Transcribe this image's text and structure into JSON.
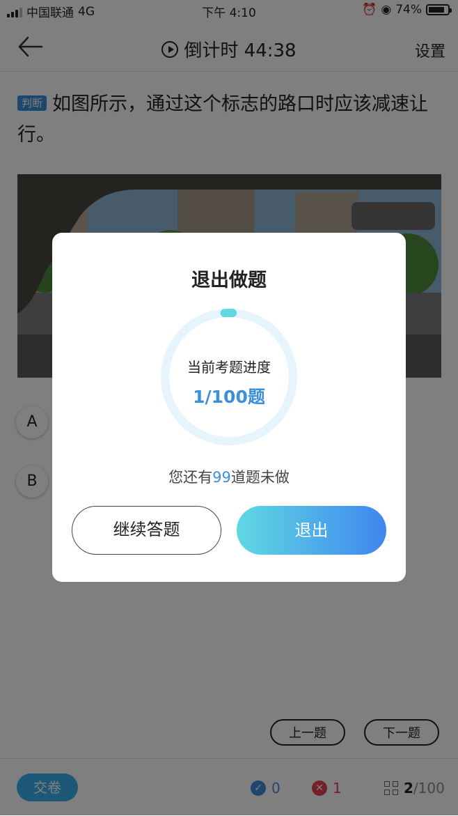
{
  "status_bar": {
    "carrier": "中国联通",
    "network": "4G",
    "time": "下午 4:10",
    "battery": "74%"
  },
  "header": {
    "title": "倒计时 44:38",
    "settings_label": "设置"
  },
  "question": {
    "tag": "判断",
    "text": "如图所示，通过这个标志的路口时应该减速让行。"
  },
  "options": [
    {
      "letter": "A"
    },
    {
      "letter": "B"
    }
  ],
  "pager": {
    "prev_label": "上一题",
    "next_label": "下一题"
  },
  "bottom_bar": {
    "submit_label": "交卷",
    "correct_count": "0",
    "wrong_count": "1",
    "current": "2",
    "total": "/100"
  },
  "dialog": {
    "title": "退出做题",
    "progress_label": "当前考题进度",
    "progress_value": "1/100题",
    "progress_fraction": 0.01,
    "remaining_prefix": "您还有",
    "remaining_count": "99",
    "remaining_suffix": "道题未做",
    "continue_label": "继续答题",
    "exit_label": "退出"
  },
  "colors": {
    "accent": "#3b8fdb",
    "ring_track": "#e6f4fb",
    "ring_progress": "#5fd8e3",
    "exit_gradient_start": "#5fd8e3",
    "exit_gradient_end": "#3f86ef"
  }
}
